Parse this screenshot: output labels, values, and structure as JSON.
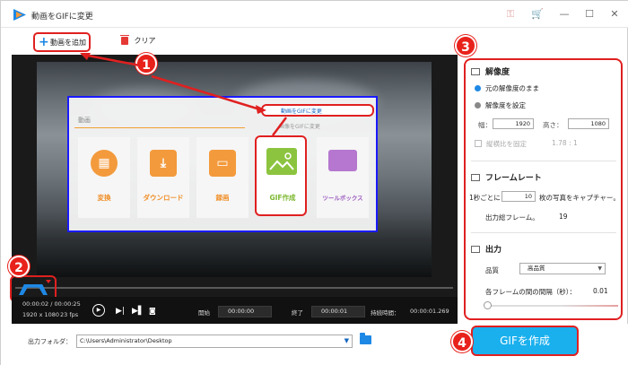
{
  "window": {
    "title": "動画をGIFに変更"
  },
  "toolbar": {
    "add_label": "動画を追加",
    "clear_label": "クリア"
  },
  "overlay_ui": {
    "video_label": "動画",
    "menu": [
      "動画をGIFに変更",
      "画像をGIFに変更"
    ],
    "tiles": [
      {
        "label": "変換",
        "icon": "film-icon"
      },
      {
        "label": "ダウンロード",
        "icon": "download-icon"
      },
      {
        "label": "録画",
        "icon": "screen-icon"
      },
      {
        "label": "GIF作成",
        "icon": "image-icon"
      },
      {
        "label": "ツールボックス",
        "icon": "toolbox-icon"
      }
    ]
  },
  "badges": {
    "b1": "1",
    "b2": "2",
    "b3": "3",
    "b4": "4"
  },
  "clip_info": {
    "duration": "00:00:02 / 00:00:25",
    "resolution": "1920 x 1080",
    "fps": "23 fps"
  },
  "controls": {
    "start_label": "開始",
    "start_value": "00:00:00",
    "end_label": "終了",
    "end_value": "00:00:01",
    "duration_label": "持続時間：",
    "duration_value": "00:00:01.269"
  },
  "footer": {
    "output_label": "出力フォルダ：",
    "output_path": "C:\\Users\\Administrator\\Desktop",
    "create_label": "GIFを作成"
  },
  "panel": {
    "resolution": {
      "title": "解像度",
      "keep_label": "元の解像度のまま",
      "set_label": "解像度を設定",
      "width_label": "幅：",
      "width_value": "1920",
      "height_label": "高さ：",
      "height_value": "1080",
      "aspect_label": "縦横比を固定",
      "aspect_value": "1.78 : 1"
    },
    "framerate": {
      "title": "フレームレート",
      "per_prefix": "1秒ごとに",
      "per_value": "10",
      "per_suffix": "枚の写真をキャプチャー。",
      "total_label": "出力総フレーム。",
      "total_value": "19"
    },
    "output": {
      "title": "出力",
      "quality_label": "品質",
      "quality_value": "高品質",
      "interval_label": "各フレームの間の間隔（秒）：",
      "interval_value": "0.01"
    }
  },
  "colors": {
    "accent": "#1e88e5",
    "highlight": "#e02020",
    "create_button": "#1ab0ee"
  }
}
